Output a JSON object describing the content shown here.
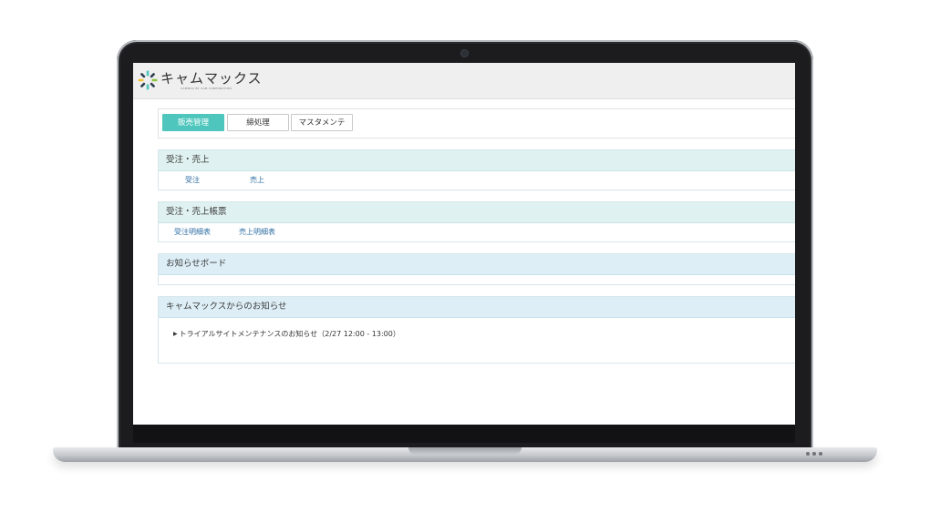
{
  "app": {
    "logo_text": "キャムマックス",
    "logo_subtext": "CAMMAX BY CAM CORPORATION"
  },
  "tabs": [
    {
      "label": "販売管理",
      "active": true
    },
    {
      "label": "締処理",
      "active": false
    },
    {
      "label": "マスタメンテ",
      "active": false
    }
  ],
  "sections": {
    "orders_sales": {
      "title": "受注・売上",
      "links": [
        "受注",
        "売上"
      ]
    },
    "reports": {
      "title": "受注・売上帳票",
      "links": [
        "受注明細表",
        "売上明細表"
      ]
    },
    "board": {
      "title": "お知らせボード"
    },
    "news": {
      "title": "キャムマックスからのお知らせ",
      "items": [
        "トライアルサイトメンテナンスのお知らせ（2/27 12:00 - 13:00）"
      ]
    }
  },
  "colors": {
    "accent": "#4ec6bd",
    "section_mint": "#dff1f0",
    "section_blue": "#ddeef6",
    "link": "#2f6fa3"
  }
}
